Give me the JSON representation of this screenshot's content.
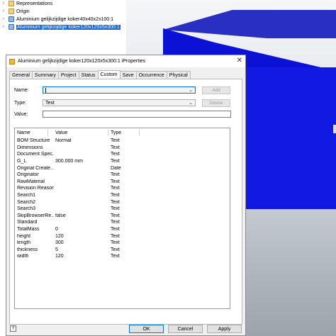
{
  "tree": {
    "items": [
      {
        "label": "Representations",
        "icon": "folder-icon"
      },
      {
        "label": "Origin",
        "icon": "folder-icon"
      },
      {
        "label": "Aluminium gelijkzijdige koker40x40x2x100:1",
        "icon": "part-icon"
      },
      {
        "label": "Aluminium gelijkzijdige koker120x120x5x300:1",
        "icon": "part-icon"
      }
    ]
  },
  "dialog": {
    "title": "Aluminium gelijkzijdige koker120x120x5x300:1 iProperties",
    "close_label": "✕",
    "tabs": [
      "General",
      "Summary",
      "Project",
      "Status",
      "Custom",
      "Save",
      "Occurrence",
      "Physical"
    ],
    "active_tab": "Custom",
    "form": {
      "name_label": "Name:",
      "name_value": "",
      "type_label": "Type:",
      "type_value": "Text",
      "value_label": "Value:",
      "value_value": "",
      "add_label": "Add",
      "delete_label": "Delete"
    },
    "grid": {
      "columns": [
        "Name",
        "Value",
        "Type"
      ],
      "rows": [
        {
          "name": "BOM Structure",
          "value": "Normal",
          "type": "Text"
        },
        {
          "name": "Dimensions",
          "value": "",
          "type": "Text"
        },
        {
          "name": "Document Spec...",
          "value": "",
          "type": "Text"
        },
        {
          "name": "G_L",
          "value": "300.000 mm",
          "type": "Text"
        },
        {
          "name": "Original Create...",
          "value": "",
          "type": "Date"
        },
        {
          "name": "Originator",
          "value": "",
          "type": "Text"
        },
        {
          "name": "RawMaterial",
          "value": "",
          "type": "Text"
        },
        {
          "name": "Revision Reason",
          "value": "",
          "type": "Text"
        },
        {
          "name": "Search1",
          "value": "",
          "type": "Text"
        },
        {
          "name": "Search2",
          "value": "",
          "type": "Text"
        },
        {
          "name": "Search3",
          "value": "",
          "type": "Text"
        },
        {
          "name": "SkipBrowserRe...",
          "value": "false",
          "type": "Text"
        },
        {
          "name": "Standard",
          "value": "",
          "type": "Text"
        },
        {
          "name": "TotalMass",
          "value": "0",
          "type": "Text"
        },
        {
          "name": "height",
          "value": "120",
          "type": "Text"
        },
        {
          "name": "length",
          "value": "300",
          "type": "Text"
        },
        {
          "name": "thickness",
          "value": "5",
          "type": "Text"
        },
        {
          "name": "width",
          "value": "120",
          "type": "Text"
        }
      ]
    },
    "buttons": {
      "ok": "OK",
      "cancel": "Cancel",
      "apply": "Apply",
      "help": "?"
    }
  },
  "colors": {
    "part_body": "#0b12d6",
    "selection": "#1667d6"
  }
}
